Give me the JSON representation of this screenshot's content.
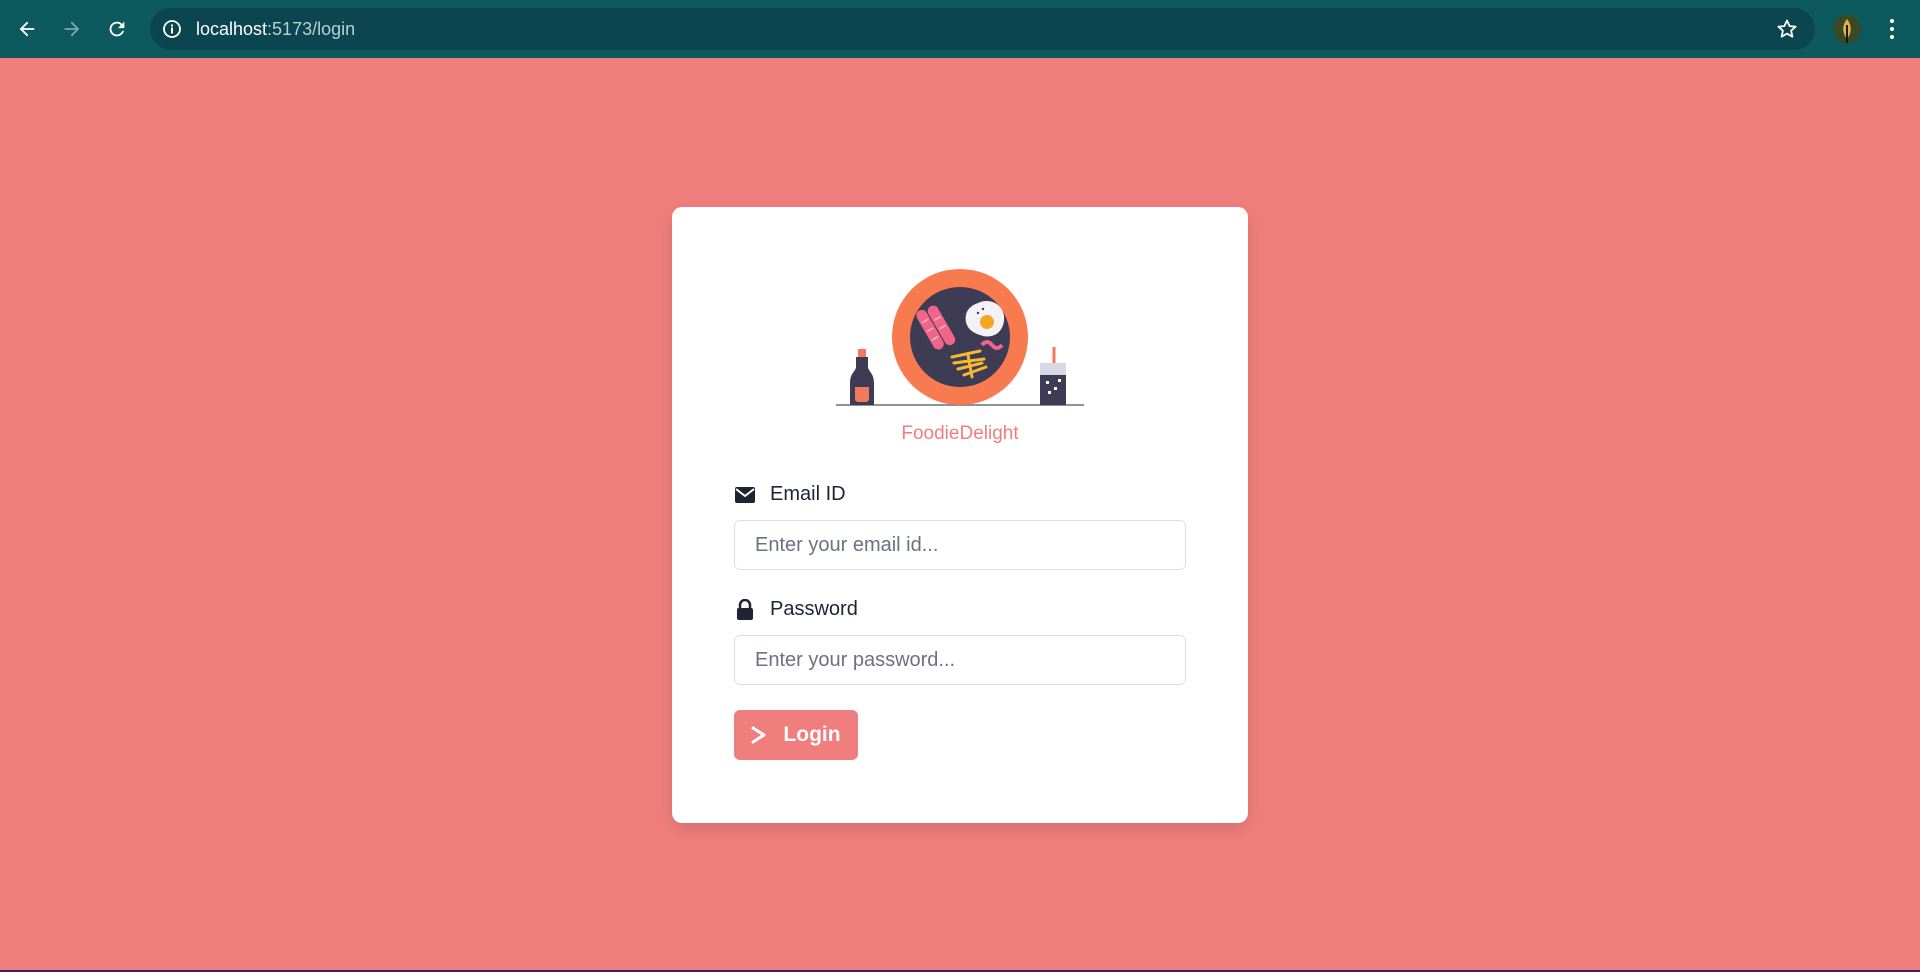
{
  "browser": {
    "url_host": "localhost",
    "url_path": ":5173/login",
    "colors": {
      "toolbar": "#0d5a5e",
      "omnibox": "#0b4650"
    }
  },
  "page": {
    "background": "#f07e7c",
    "brand_name": "FoodieDelight",
    "email": {
      "label": "Email ID",
      "placeholder": "Enter your email id...",
      "icon": "envelope-icon"
    },
    "password": {
      "label": "Password",
      "placeholder": "Enter your password...",
      "icon": "lock-icon"
    },
    "login_button": {
      "label": "Login",
      "icon": "chevron-right-icon"
    }
  }
}
